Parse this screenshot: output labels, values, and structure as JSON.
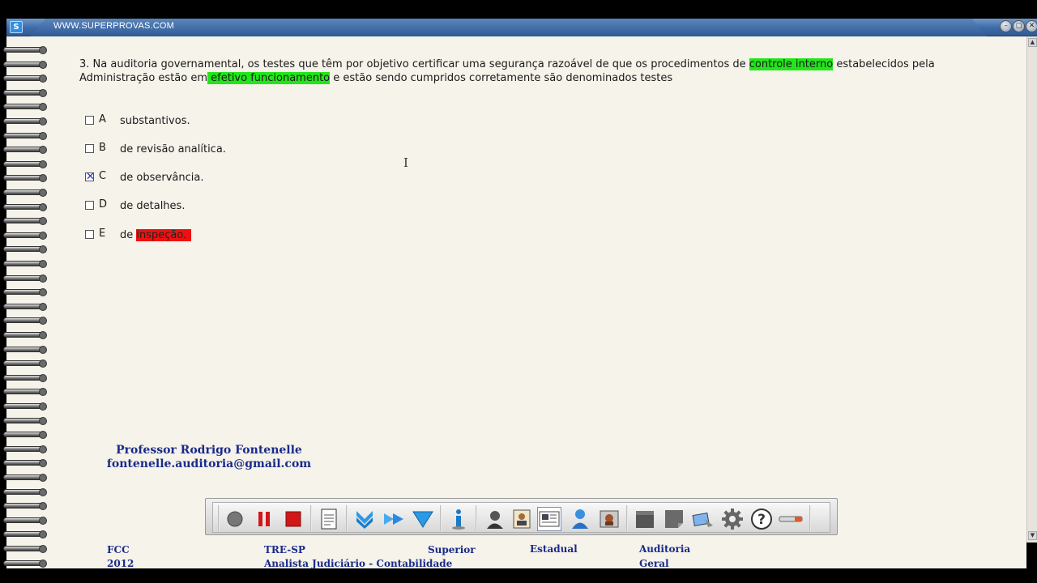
{
  "window": {
    "url": "WWW.SUPERPROVAS.COM",
    "controls": [
      "minimize",
      "restore",
      "close"
    ]
  },
  "question": {
    "parts": [
      {
        "text": "3. Na auditoria governamental, os testes que têm por objetivo certificar uma segurança razoável de que os procedimentos de ",
        "hl": ""
      },
      {
        "text": "controle interno",
        "hl": "green"
      },
      {
        "text": " estabelecidos pela Administração estão em",
        "hl": ""
      },
      {
        "text": " efetivo funcionamento",
        "hl": "green"
      },
      {
        "text": " e estão sendo cumpridos corretamente são denominados testes",
        "hl": ""
      }
    ]
  },
  "options": [
    {
      "letter": "A",
      "text": "substantivos.",
      "checked": false
    },
    {
      "letter": "B",
      "text": "de revisão analítica.",
      "checked": false
    },
    {
      "letter": "C",
      "text": "de observância.",
      "checked": true
    },
    {
      "letter": "D",
      "text": "de detalhes.",
      "checked": false
    },
    {
      "letter": "E",
      "text_plain": "de ",
      "text_hl": "inspeção.",
      "checked": false
    }
  ],
  "check_mark": "✕",
  "professor": {
    "name": "Professor Rodrigo Fontenelle",
    "email": "fontenelle.auditoria@gmail.com"
  },
  "toolbar": {
    "tools": [
      "record-icon",
      "pause-icon",
      "stop-icon",
      "document-icon",
      "download-arrow-icon",
      "forward-arrow-icon",
      "funnel-icon",
      "info-icon",
      "teacher-icon",
      "id-card-icon",
      "news-card-icon",
      "user-icon",
      "photo-icon",
      "clapper-icon",
      "note-icon",
      "eraser-icon",
      "gear-icon",
      "help-icon",
      "minimize-bar-icon"
    ]
  },
  "footer": {
    "banca": "FCC",
    "ano": "2012",
    "orgao": "TRE-SP",
    "cargo": "Analista Judiciário - Contabilidade",
    "nivel": "Superior",
    "esfera": "Estadual",
    "materia": "Auditoria",
    "assunto": "Geral"
  },
  "colors": {
    "highlight_green": "#22e61a",
    "highlight_red": "#ee1111",
    "accent_blue": "#1a2a8a"
  }
}
